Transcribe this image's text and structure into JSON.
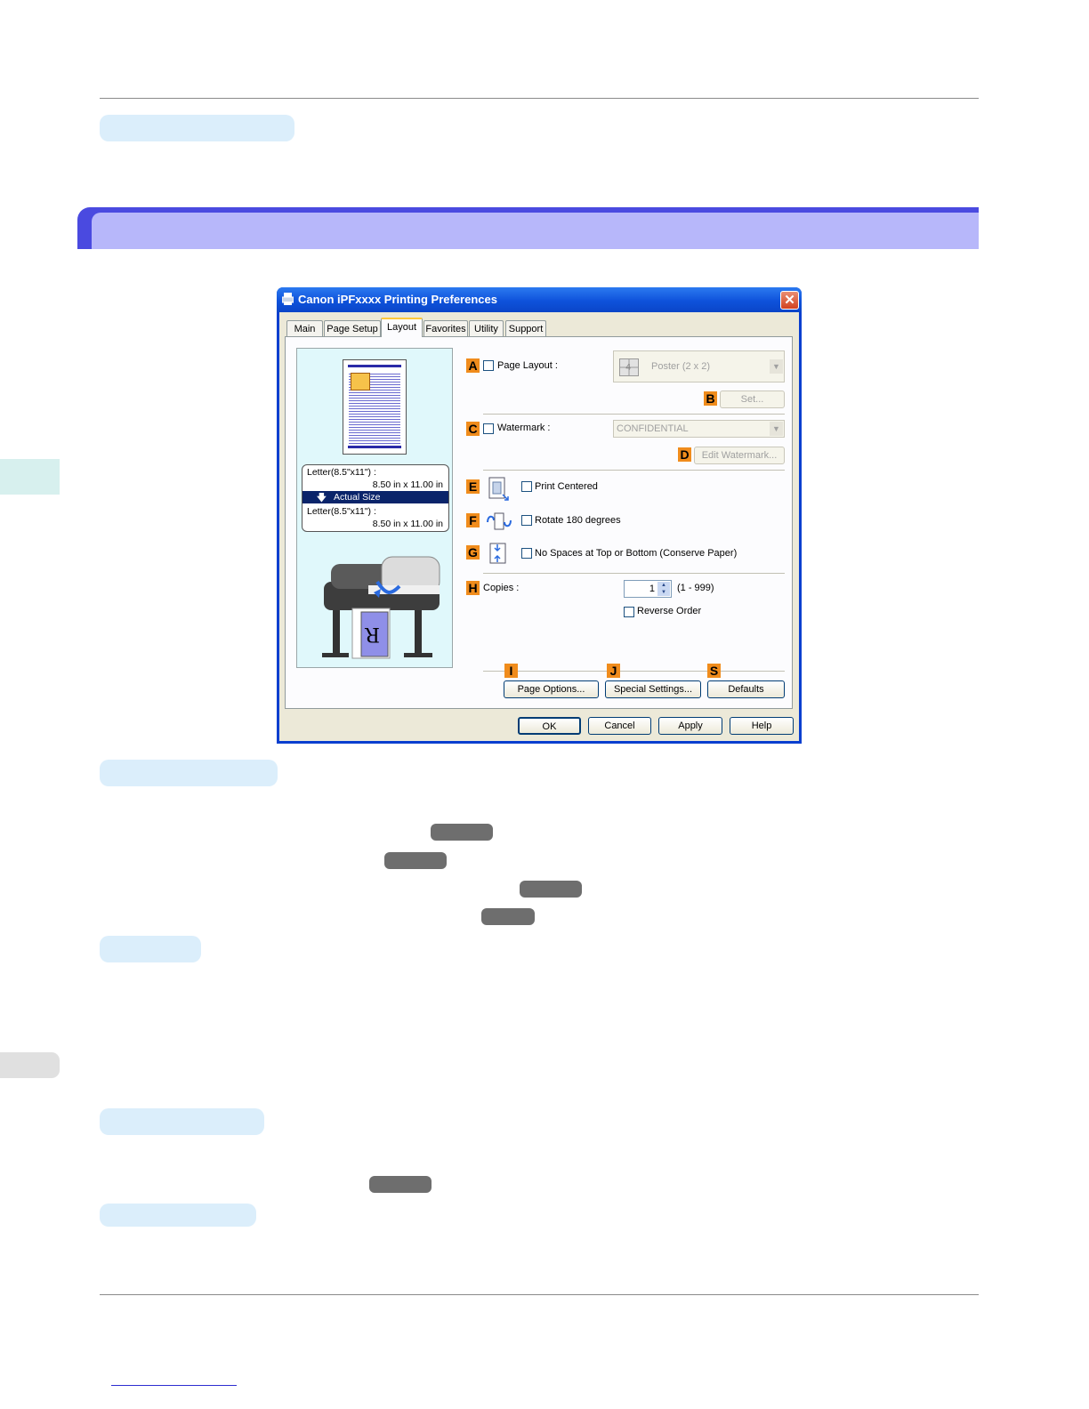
{
  "dialog": {
    "title": "Canon iPFxxxx Printing Preferences",
    "close_label": "✕",
    "tabs": [
      "Main",
      "Page Setup",
      "Layout",
      "Favorites",
      "Utility",
      "Support"
    ],
    "active_tab": "Layout",
    "preview": {
      "orig_size": "Letter(8.5\"x11\") :",
      "orig_dims": "8.50 in x 11.00 in",
      "scaling": "Actual Size",
      "out_size": "Letter(8.5\"x11\") :",
      "out_dims": "8.50 in x 11.00 in"
    },
    "badges": {
      "a": "A",
      "b": "B",
      "c": "C",
      "d": "D",
      "e": "E",
      "f": "F",
      "g": "G",
      "h": "H",
      "i": "I",
      "j": "J",
      "s": "S"
    },
    "page_layout": {
      "label": "Page Layout :",
      "value": "Poster (2 x 2)",
      "set_button": "Set...",
      "checked": false
    },
    "watermark": {
      "label": "Watermark :",
      "value": "CONFIDENTIAL",
      "edit_button": "Edit Watermark...",
      "checked": false
    },
    "print_centered": {
      "label": "Print Centered",
      "checked": false
    },
    "rotate": {
      "label": "Rotate 180 degrees",
      "checked": false
    },
    "no_spaces": {
      "label": "No Spaces at Top or Bottom (Conserve Paper)",
      "checked": false
    },
    "copies": {
      "label": "Copies :",
      "value": "1",
      "range": "(1 - 999)"
    },
    "reverse_order": {
      "label": "Reverse Order",
      "checked": false
    },
    "buttons": {
      "page_options": "Page Options...",
      "special_settings": "Special Settings...",
      "defaults": "Defaults",
      "ok": "OK",
      "cancel": "Cancel",
      "apply": "Apply",
      "help": "Help"
    }
  },
  "colors": {
    "section_bar": "#4a4ae0",
    "section_bar_inner": "#b7b7fa",
    "pill": "#dbeefb",
    "badge": "#f08c1c",
    "gray_key": "#6e6e6e"
  }
}
